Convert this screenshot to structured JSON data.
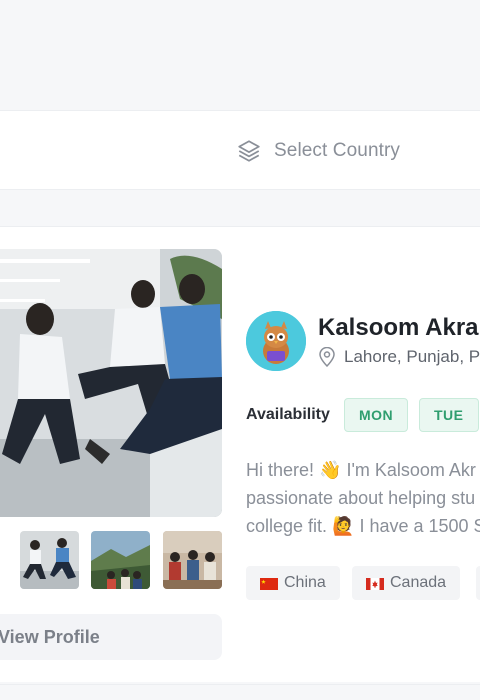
{
  "filters": {
    "country_select_label": "Select Country"
  },
  "profile": {
    "name": "Kalsoom Akra",
    "location": "Lahore, Punjab, P",
    "view_profile_label": "View Profile",
    "availability_label": "Availability",
    "days": [
      "MON",
      "TUE"
    ],
    "bio_lines": [
      "Hi there! 👋 I'm Kalsoom Akr",
      "passionate about helping stu",
      "college fit. 🙋 I have a 1500 S"
    ],
    "countries": [
      {
        "label": "China",
        "flag": "china-flag-icon"
      },
      {
        "label": "Canada",
        "flag": "canada-flag-icon"
      }
    ]
  },
  "colors": {
    "accent_green": "#2f9e6f",
    "avatar_bg": "#4cc9dd",
    "muted_text": "#8a8f98"
  }
}
